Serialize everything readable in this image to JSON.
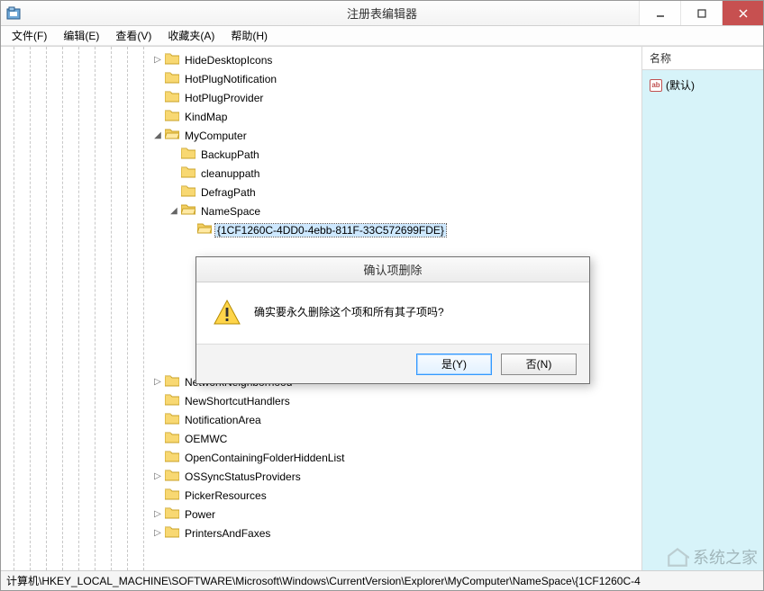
{
  "window": {
    "title": "注册表编辑器"
  },
  "menus": {
    "file": "文件(F)",
    "edit": "编辑(E)",
    "view": "查看(V)",
    "favorites": "收藏夹(A)",
    "help": "帮助(H)"
  },
  "tree": {
    "items": [
      {
        "label": "HideDesktopIcons",
        "expander": "collapsed",
        "depth": 0
      },
      {
        "label": "HotPlugNotification",
        "expander": "none",
        "depth": 0
      },
      {
        "label": "HotPlugProvider",
        "expander": "none",
        "depth": 0
      },
      {
        "label": "KindMap",
        "expander": "none",
        "depth": 0
      },
      {
        "label": "MyComputer",
        "expander": "expanded",
        "depth": 0
      },
      {
        "label": "BackupPath",
        "expander": "none",
        "depth": 1
      },
      {
        "label": "cleanuppath",
        "expander": "none",
        "depth": 1
      },
      {
        "label": "DefragPath",
        "expander": "none",
        "depth": 1
      },
      {
        "label": "NameSpace",
        "expander": "expanded",
        "depth": 1
      },
      {
        "label": "{1CF1260C-4DD0-4ebb-811F-33C572699FDE}",
        "expander": "none",
        "depth": 2,
        "selected": true
      },
      {
        "label": "NetworkNeighborhood",
        "expander": "collapsed",
        "depth": 0
      },
      {
        "label": "NewShortcutHandlers",
        "expander": "none",
        "depth": 0
      },
      {
        "label": "NotificationArea",
        "expander": "none",
        "depth": 0
      },
      {
        "label": "OEMWC",
        "expander": "none",
        "depth": 0
      },
      {
        "label": "OpenContainingFolderHiddenList",
        "expander": "none",
        "depth": 0
      },
      {
        "label": "OSSyncStatusProviders",
        "expander": "collapsed",
        "depth": 0
      },
      {
        "label": "PickerResources",
        "expander": "none",
        "depth": 0
      },
      {
        "label": "Power",
        "expander": "collapsed",
        "depth": 0
      },
      {
        "label": "PrintersAndFaxes",
        "expander": "collapsed",
        "depth": 0
      }
    ]
  },
  "values": {
    "header": "名称",
    "default_name": "(默认)",
    "default_icon_text": "ab"
  },
  "dialog": {
    "title": "确认项删除",
    "message": "确实要永久删除这个项和所有其子项吗?",
    "yes": "是(Y)",
    "no": "否(N)"
  },
  "statusbar": {
    "path": "计算机\\HKEY_LOCAL_MACHINE\\SOFTWARE\\Microsoft\\Windows\\CurrentVersion\\Explorer\\MyComputer\\NameSpace\\{1CF1260C-4"
  },
  "watermark": {
    "text": "系统之家"
  }
}
